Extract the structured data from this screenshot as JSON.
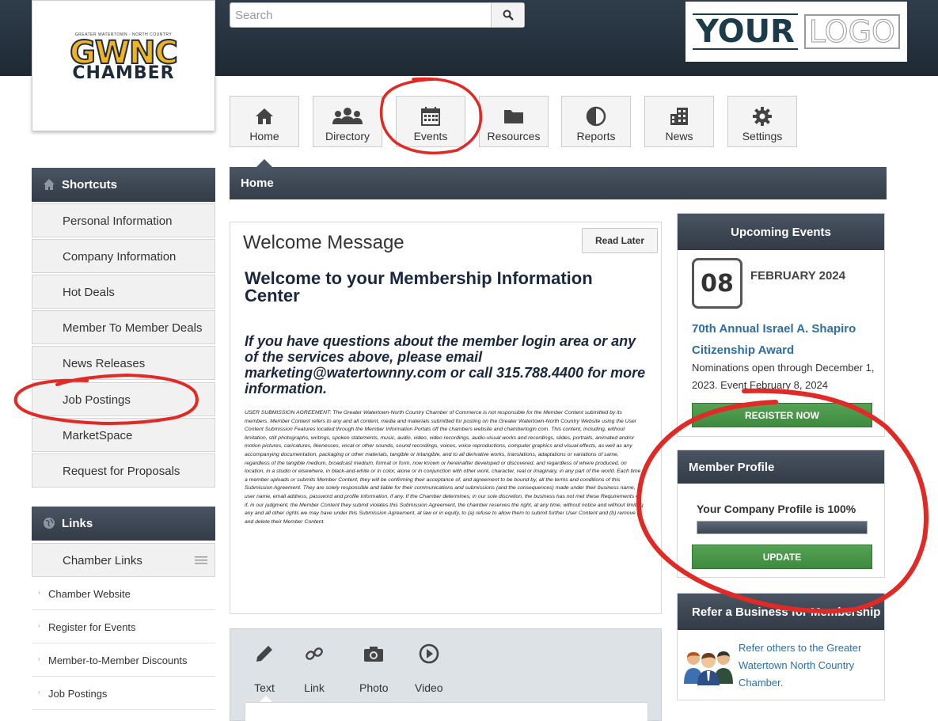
{
  "header": {
    "logo_small_text": "GREATER WATERTOWN - NORTH COUNTRY",
    "logo_main": "GWNC",
    "logo_sub": "CHAMBER",
    "search_placeholder": "Search",
    "brand_logo_word1": "YOUR",
    "brand_logo_word2": "LOGO"
  },
  "nav": [
    {
      "label": "Home",
      "icon": "home-icon"
    },
    {
      "label": "Directory",
      "icon": "people-icon"
    },
    {
      "label": "Events",
      "icon": "calendar-icon"
    },
    {
      "label": "Resources",
      "icon": "folder-icon"
    },
    {
      "label": "Reports",
      "icon": "pie-chart-icon"
    },
    {
      "label": "News",
      "icon": "building-icon"
    },
    {
      "label": "Settings",
      "icon": "gear-icon"
    }
  ],
  "breadcrumb": "Home",
  "sidebar": {
    "shortcuts_title": "Shortcuts",
    "shortcuts": [
      "Personal Information",
      "Company Information",
      "Hot Deals",
      "Member To Member Deals",
      "News Releases",
      "Job Postings",
      "MarketSpace",
      "Request for Proposals"
    ],
    "links_title": "Links",
    "links_group": "Chamber Links",
    "links": [
      "Chamber Website",
      "Register for Events",
      "Member-to-Member Discounts",
      "Job Postings"
    ]
  },
  "welcome": {
    "title": "Welcome Message",
    "read_later": "Read Later",
    "heading": "Welcome to your Membership Information Center",
    "subheading": "If you have questions about the member login area or any of the services above, please email marketing@watertownny.com or call 315.788.4400 for more information.",
    "legal": "USER SUBMISSION AGREEMENT: The Greater Watertown-North Country Chamber of Commerce is not responsible for the Member Content submitted by its members. Member Content refers to any and all content, media and materials submitted for posting on the Greater Watertown-North Country Website using the User Content Submission Features located through the Member Information Portals off the chambers website and chamberlogin.com. This content, including, without limitation, still photographs, writings, spoken statements, music, audio, video, video recordings, audio-visual works and recordings, slides, portraits, animated and/or motion pictures, caricatures, likenesses, vocal or other sounds, sound recordings, voices, voice reproductions, computer graphics and visual effects, as well as any accompanying documentation, packaging or other materials, tangible or intangible, and to all derivative works, translations, adaptations or variations of same, regardless of the tangible medium, broadcast medium, format or form, now known or hereinafter developed or discovered, and regardless of where produced, on location, in a studio or elsewhere, in black-and-white or in color, alone or in conjunction with other work, character, real or imaginary, in any part of the world. Each time a member uploads or submits Member Content, they will be confirming their acceptance of, and agreement to be bound by, all the terms and conditions of this Submission Agreement. They are solely responsible and liable for their communications and submissions (and the consequences) made under their business name, user name, email address, password and profile information, if any. If the Chamber determines, in our sole discretion, the business has not met these Requirements or if, in our judgment, the Member Content they submit violates this Submission Agreement, the chamber reserves the right, at any time, without notice and without limiting any and all other rights we may have under this Submission Agreement, at law or in equity, to (a) refuse to allow them to submit further User Content and (b) remove and delete their Member Content."
  },
  "post": {
    "tools": [
      {
        "label": "Text",
        "icon": "pencil-icon"
      },
      {
        "label": "Link",
        "icon": "link-icon"
      },
      {
        "label": "Photo",
        "icon": "camera-icon"
      },
      {
        "label": "Video",
        "icon": "play-icon"
      }
    ]
  },
  "events": {
    "title": "Upcoming Events",
    "day": "08",
    "month": "FEBRUARY 2024",
    "event_title": "70th Annual Israel A. Shapiro Citizenship Award",
    "event_desc": "Nominations open through December 1, 2023. Event February 8, 2024",
    "register": "REGISTER NOW"
  },
  "profile": {
    "title": "Member Profile",
    "status": "Your Company Profile is 100%",
    "progress": 100,
    "update": "UPDATE"
  },
  "refer": {
    "title": "Refer a Business for Membership",
    "text": "Refer others to the Greater Watertown North Country Chamber."
  },
  "colors": {
    "header_dark": "#1e2933",
    "panel_head": "#3d4652",
    "link_blue": "#2d6ea7",
    "green": "#4a964a",
    "annotation_red": "#e02a26"
  }
}
